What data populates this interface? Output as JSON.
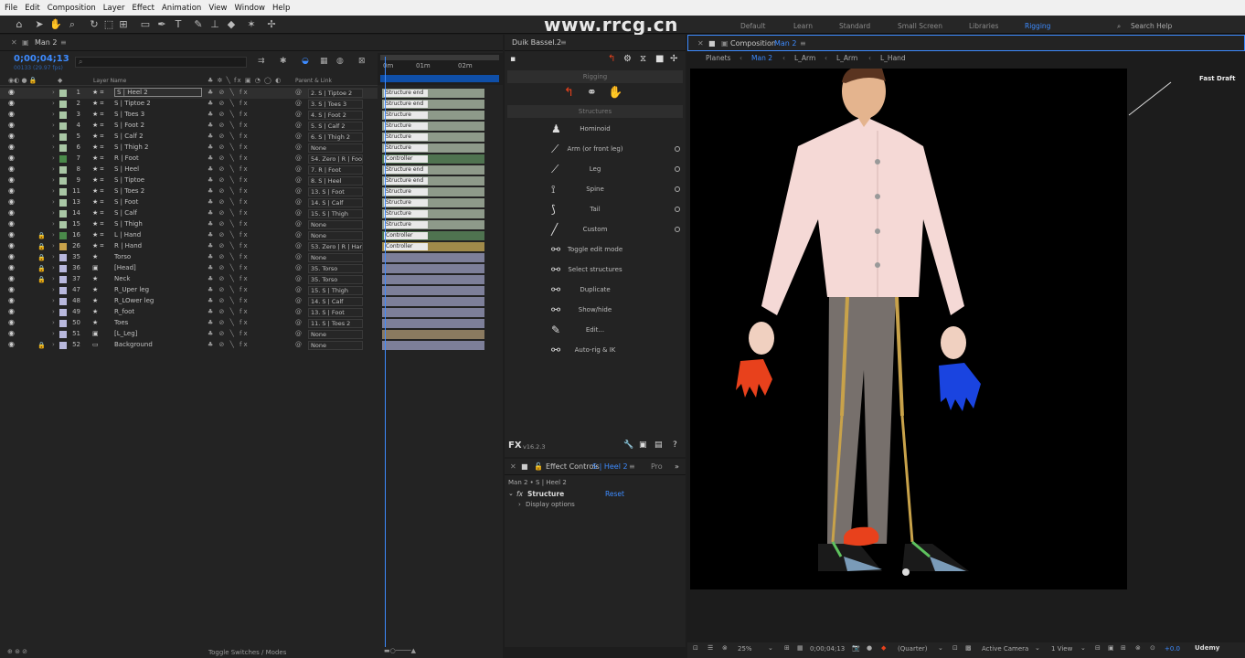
{
  "menu": [
    "File",
    "Edit",
    "Composition",
    "Layer",
    "Effect",
    "Animation",
    "View",
    "Window",
    "Help"
  ],
  "watermark": "www.rrcg.cn",
  "workspaces": [
    "Default",
    "Learn",
    "Standard",
    "Small Screen",
    "Libraries",
    "Rigging"
  ],
  "search_help": "Search Help",
  "timeline": {
    "tab": "Man 2",
    "timecode": "0;00;04;13",
    "timecode_sub": "00133 (29.97 fps)",
    "col_layer_name": "Layer Name",
    "col_parent": "Parent & Link",
    "ruler": [
      "0m",
      "01m",
      "02m"
    ],
    "footer": "Toggle Switches / Modes",
    "layers": [
      {
        "num": "1",
        "type": "star",
        "name": "S | Heel 2",
        "parent": "2. S | Tiptoe 2",
        "bar": "Structure end",
        "label": "#a9c7a5",
        "lock": false,
        "bar_color": "#8e9a8a",
        "selected": true
      },
      {
        "num": "2",
        "type": "star",
        "name": "S | Tiptoe 2",
        "parent": "3. S | Toes 3",
        "bar": "Structure end",
        "label": "#a9c7a5",
        "lock": false,
        "bar_color": "#8e9a8a"
      },
      {
        "num": "3",
        "type": "star",
        "name": "S | Toes 3",
        "parent": "4. S | Foot 2",
        "bar": "Structure",
        "label": "#a9c7a5",
        "lock": false,
        "bar_color": "#8e9a8a"
      },
      {
        "num": "4",
        "type": "star",
        "name": "S | Foot 2",
        "parent": "5. S | Calf 2",
        "bar": "Structure",
        "label": "#a9c7a5",
        "lock": false,
        "bar_color": "#8e9a8a"
      },
      {
        "num": "5",
        "type": "star",
        "name": "S | Calf 2",
        "parent": "6. S | Thigh 2",
        "bar": "Structure",
        "label": "#a9c7a5",
        "lock": false,
        "bar_color": "#8e9a8a"
      },
      {
        "num": "6",
        "type": "star",
        "name": "S | Thigh 2",
        "parent": "None",
        "bar": "Structure",
        "label": "#a9c7a5",
        "lock": false,
        "bar_color": "#8e9a8a"
      },
      {
        "num": "7",
        "type": "star",
        "name": "R | Foot",
        "parent": "54. Zero | R | Foot",
        "bar": "Controller",
        "label": "#4a8a4a",
        "lock": false,
        "bar_color": "#4f7350"
      },
      {
        "num": "8",
        "type": "star",
        "name": "S | Heel",
        "parent": "7. R | Foot",
        "bar": "Structure end",
        "label": "#a9c7a5",
        "lock": false,
        "bar_color": "#8e9a8a"
      },
      {
        "num": "9",
        "type": "star",
        "name": "S | Tiptoe",
        "parent": "8. S | Heel",
        "bar": "Structure end",
        "label": "#a9c7a5",
        "lock": false,
        "bar_color": "#8e9a8a"
      },
      {
        "num": "11",
        "type": "star",
        "name": "S | Toes 2",
        "parent": "13. S | Foot",
        "bar": "Structure",
        "label": "#a9c7a5",
        "lock": false,
        "bar_color": "#8e9a8a"
      },
      {
        "num": "13",
        "type": "star",
        "name": "S | Foot",
        "parent": "14. S | Calf",
        "bar": "Structure",
        "label": "#a9c7a5",
        "lock": false,
        "bar_color": "#8e9a8a"
      },
      {
        "num": "14",
        "type": "star",
        "name": "S | Calf",
        "parent": "15. S | Thigh",
        "bar": "Structure",
        "label": "#a9c7a5",
        "lock": false,
        "bar_color": "#8e9a8a"
      },
      {
        "num": "15",
        "type": "star",
        "name": "S | Thigh",
        "parent": "None",
        "bar": "Structure",
        "label": "#a9c7a5",
        "lock": false,
        "bar_color": "#8e9a8a"
      },
      {
        "num": "16",
        "type": "star",
        "name": "L | Hand",
        "parent": "None",
        "bar": "Controller",
        "label": "#4a8a4a",
        "lock": true,
        "bar_color": "#4f7350"
      },
      {
        "num": "26",
        "type": "star",
        "name": "R | Hand",
        "parent": "53. Zero | R | Hand",
        "bar": "Controller",
        "label": "#c8a24a",
        "lock": true,
        "bar_color": "#a08a4a"
      },
      {
        "num": "35",
        "type": "shape",
        "name": "Torso",
        "parent": "None",
        "bar": "",
        "label": "#b8b8dd",
        "lock": true,
        "bar_color": "#7d7f99"
      },
      {
        "num": "36",
        "type": "comp",
        "name": "[Head]",
        "parent": "35. Torso",
        "bar": "",
        "label": "#b8b8dd",
        "lock": true,
        "bar_color": "#7d7f99"
      },
      {
        "num": "37",
        "type": "shape",
        "name": "Neck",
        "parent": "35. Torso",
        "bar": "",
        "label": "#b8b8dd",
        "lock": true,
        "bar_color": "#7d7f99"
      },
      {
        "num": "47",
        "type": "shape",
        "name": "R_Uper leg",
        "parent": "15. S | Thigh",
        "bar": "",
        "label": "#b8b8dd",
        "lock": false,
        "bar_color": "#7d7f99"
      },
      {
        "num": "48",
        "type": "shape",
        "name": "R_LOwer leg",
        "parent": "14. S | Calf",
        "bar": "",
        "label": "#b8b8dd",
        "lock": false,
        "bar_color": "#7d7f99"
      },
      {
        "num": "49",
        "type": "shape",
        "name": "R_foot",
        "parent": "13. S | Foot",
        "bar": "",
        "label": "#b8b8dd",
        "lock": false,
        "bar_color": "#7d7f99"
      },
      {
        "num": "50",
        "type": "shape",
        "name": "Toes",
        "parent": "11. S | Toes 2",
        "bar": "",
        "label": "#b8b8dd",
        "lock": false,
        "bar_color": "#7d7f99"
      },
      {
        "num": "51",
        "type": "comp",
        "name": "[L_Leg]",
        "parent": "None",
        "bar": "",
        "label": "#b8b8dd",
        "lock": false,
        "bar_color": "#8a7a60"
      },
      {
        "num": "52",
        "type": "solid",
        "name": "Background",
        "parent": "None",
        "bar": "",
        "label": "#b8b8dd",
        "lock": true,
        "bar_color": "#7d7f99"
      }
    ]
  },
  "duik": {
    "tab": "Duik Bassel.2",
    "section_rigging": "Rigging",
    "section_structures": "Structures",
    "buttons": [
      {
        "label": "Hominoid",
        "dot": false
      },
      {
        "label": "Arm (or front leg)",
        "dot": true
      },
      {
        "label": "Leg",
        "dot": true
      },
      {
        "label": "Spine",
        "dot": true
      },
      {
        "label": "Tail",
        "dot": true
      },
      {
        "label": "Custom",
        "dot": true
      },
      {
        "label": "Toggle edit mode",
        "dot": false
      },
      {
        "label": "Select structures",
        "dot": false
      },
      {
        "label": "Duplicate",
        "dot": false
      },
      {
        "label": "Show/hide",
        "dot": false
      },
      {
        "label": "Edit...",
        "dot": false
      },
      {
        "label": "Auto-rig & IK",
        "dot": false
      }
    ],
    "version": "v16.2.3"
  },
  "effects": {
    "tab": "Effect Controls",
    "tab_layer": "S | Heel 2",
    "tab_more": "Pro",
    "path": "Man 2 • S | Heel 2",
    "effect_name": "Structure",
    "reset": "Reset",
    "sub": "Display options"
  },
  "comp": {
    "tab": "Composition",
    "tab_name": "Man 2",
    "breadcrumbs": [
      "Planets",
      "Man 2",
      "L_Arm",
      "L_Arm",
      "L_Hand"
    ],
    "fast_draft": "Fast Draft",
    "zoom": "25%",
    "timecode": "0;00;04;13",
    "resolution": "(Quarter)",
    "camera": "Active Camera",
    "views": "1 View",
    "offset": "+0.0",
    "udemy": "Udemy"
  },
  "colors": {
    "accent": "#3d8bff",
    "viewer_bg": "#000000",
    "hand_left": "#e8411c",
    "hand_right": "#1a44e0"
  }
}
